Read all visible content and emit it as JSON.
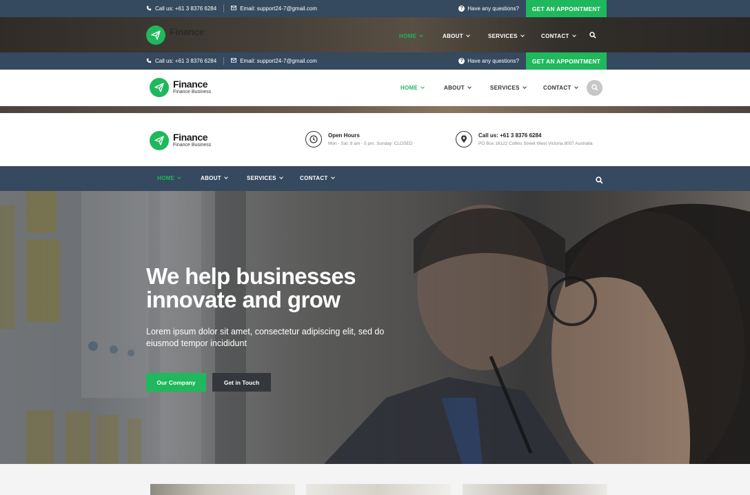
{
  "contact": {
    "call": "Call us: +61 3 8376 6284",
    "email": "Email: support24-7@gmail.com",
    "question": "Have any questions?",
    "appointment_button": "GET AN APPOINTMENT"
  },
  "brand": {
    "name": "Finance",
    "tagline": "Finance Business"
  },
  "nav": {
    "items": [
      {
        "label": "HOME",
        "active": true
      },
      {
        "label": "ABOUT",
        "active": false
      },
      {
        "label": "SERVICES",
        "active": false
      },
      {
        "label": "CONTACT",
        "active": false
      }
    ]
  },
  "info": {
    "hours_title": "Open Hours",
    "hours_text": "Mon - Sat: 8 am - 5 pm, Sunday: CLOSED",
    "call_title": "Call us: +61 3 8376 6284",
    "address": "PO Box 16122 Collins Street West Victoria 8007 Australia"
  },
  "hero": {
    "headline_line1": "We help businesses",
    "headline_line2": "innovate and grow",
    "text": "Lorem ipsum dolor sit amet, consectetur adipiscing elit, sed do eiusmod tempor incididunt",
    "primary_button": "Our Company",
    "secondary_button": "Get in Touch"
  },
  "colors": {
    "accent": "#1fb85c",
    "navbar": "#35495f",
    "topbar": "#35495f",
    "dark_button": "#34373b"
  }
}
